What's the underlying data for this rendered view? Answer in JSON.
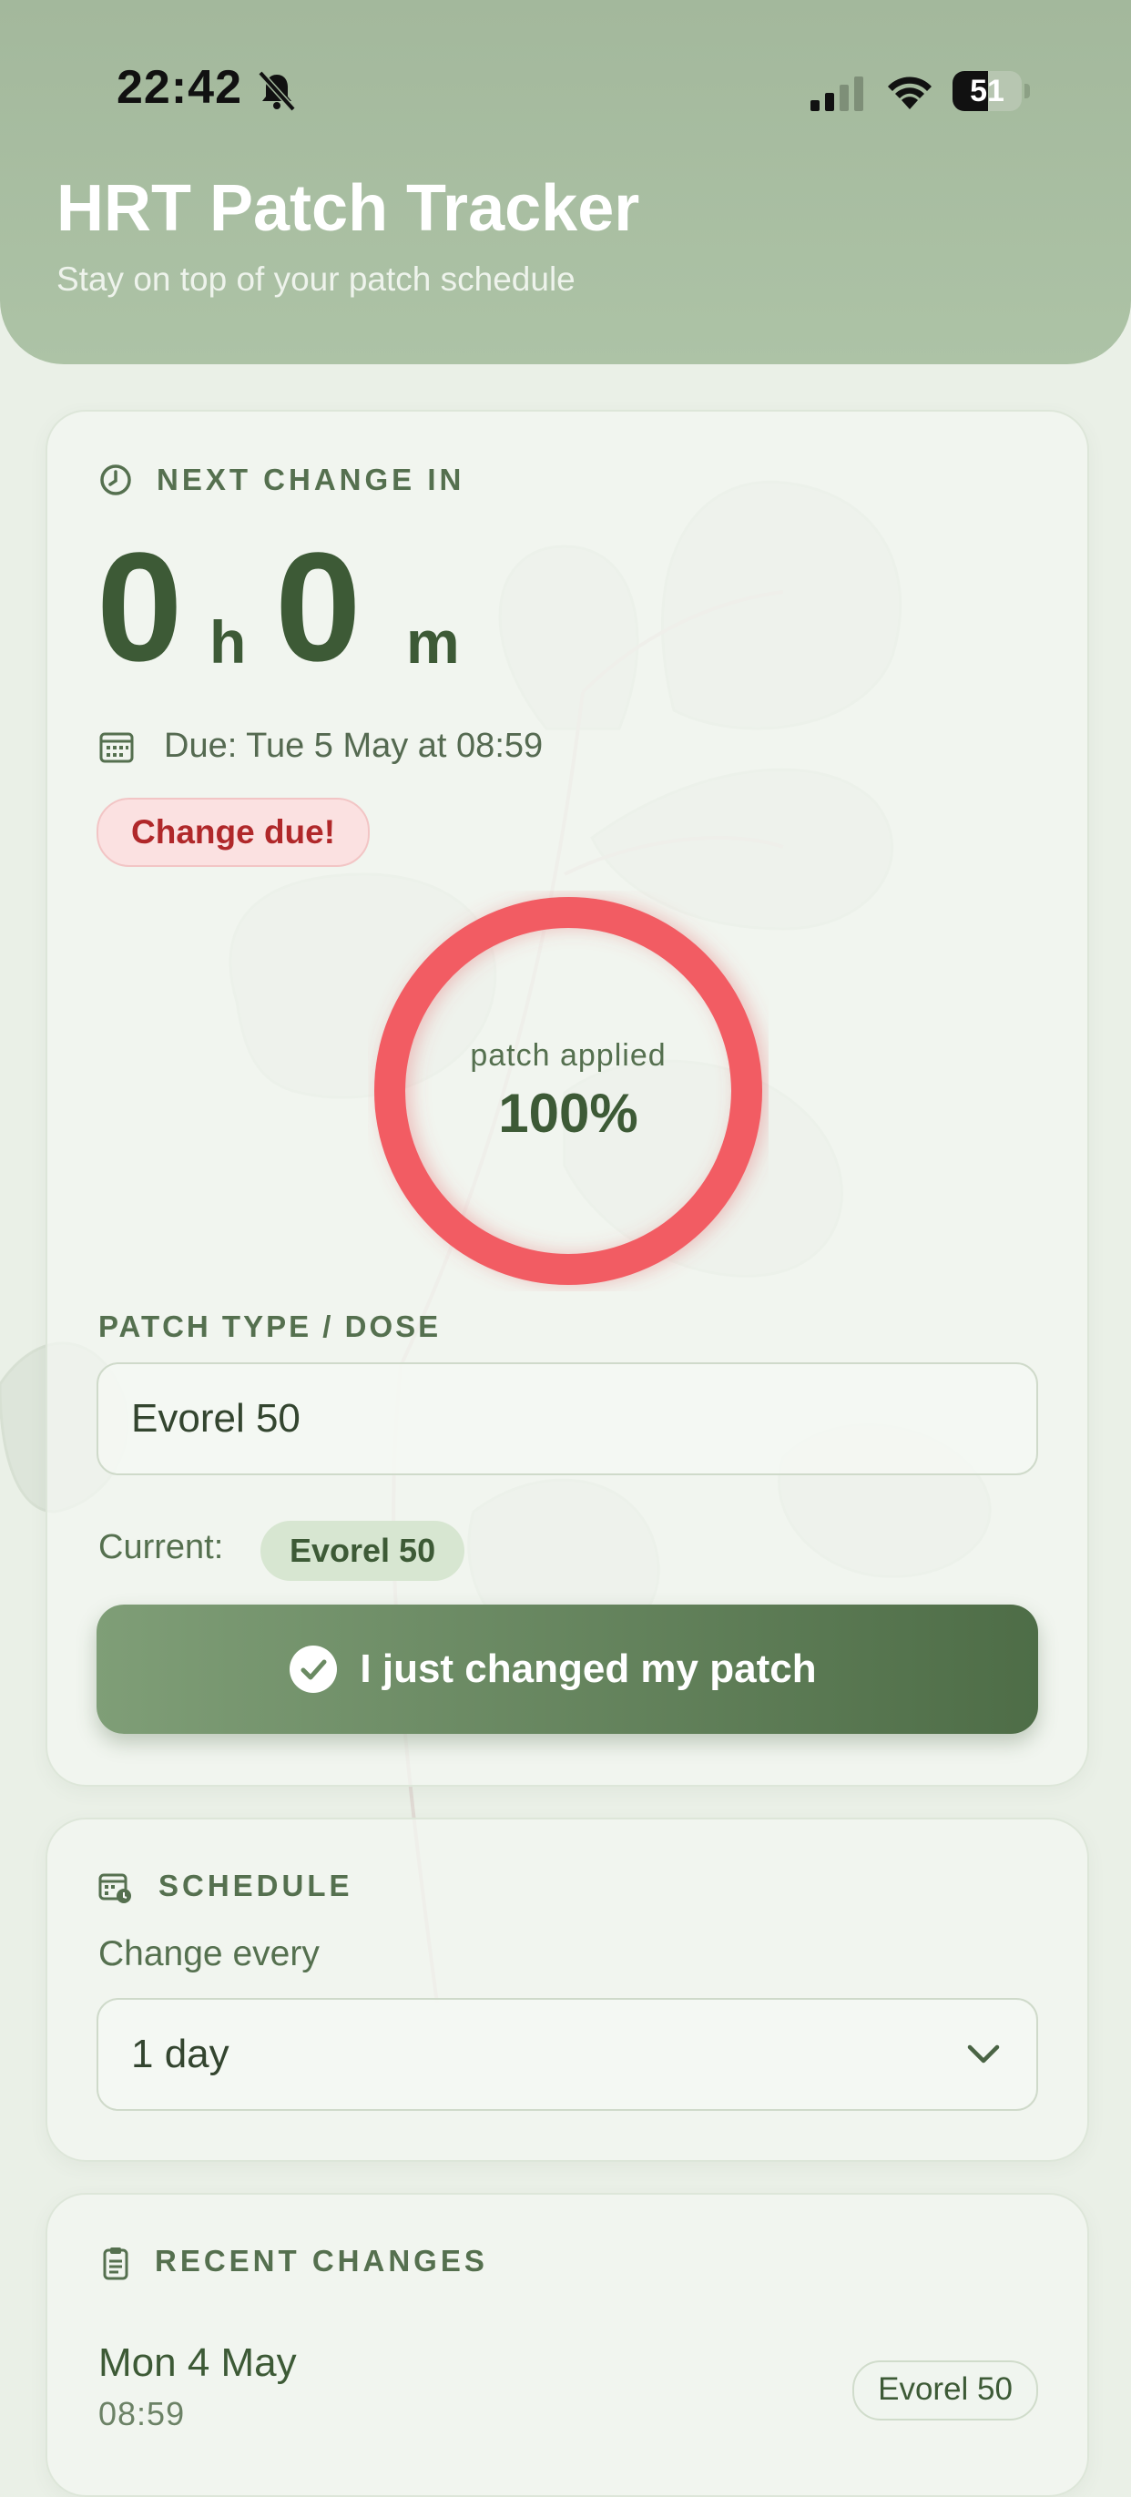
{
  "status_bar": {
    "time": "22:42",
    "battery": "51",
    "battery_level": 0.51
  },
  "header": {
    "title": "HRT Patch Tracker",
    "subtitle": "Stay on top of your patch schedule"
  },
  "next_change": {
    "heading": "NEXT CHANGE IN",
    "hours": "0",
    "hours_unit": "h",
    "minutes": "0",
    "minutes_unit": "m",
    "due_text": "Due: Tue 5 May at 08:59",
    "badge": "Change due!",
    "ring_label": "patch applied",
    "ring_value": "100%",
    "ring_progress": 1.0,
    "ring_color": "#f25c63"
  },
  "patch": {
    "label": "PATCH TYPE / DOSE",
    "input_value": "Evorel 50",
    "current_label": "Current:",
    "current_value": "Evorel 50",
    "button_label": "I just changed my patch"
  },
  "schedule": {
    "heading": "SCHEDULE",
    "change_every_label": "Change every",
    "selected": "1 day"
  },
  "recent": {
    "heading": "RECENT CHANGES",
    "items": [
      {
        "date": "Mon 4 May",
        "time": "08:59",
        "patch": "Evorel 50"
      }
    ]
  },
  "colors": {
    "accent": "#4e6d47",
    "header": "#a3b89c",
    "alert": "#b0282a"
  }
}
